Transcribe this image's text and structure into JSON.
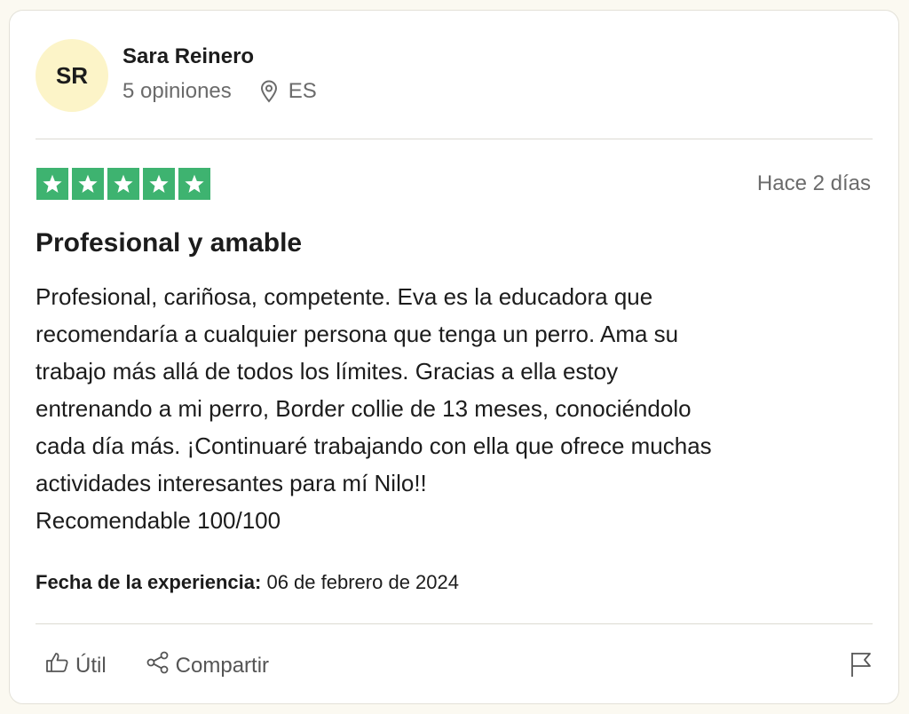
{
  "reviewer": {
    "initials": "SR",
    "name": "Sara Reinero",
    "review_count": "5 opiniones",
    "country": "ES"
  },
  "review": {
    "rating": 5,
    "rating_max": 5,
    "star_color": "#3eb370",
    "date_ago": "Hace 2 días",
    "title": "Profesional y amable",
    "body": "Profesional, cariñosa, competente. Eva es la educadora que\nrecomendaría a cualquier persona que tenga un perro. Ama su\ntrabajo más allá de todos los límites. Gracias a ella estoy\nentrenando a mi perro, Border collie de 13 meses, conociéndolo\ncada día más. ¡Continuaré trabajando con ella que ofrece muchas\nactividades interesantes para mí Nilo!!\nRecomendable 100/100",
    "experience_label": "Fecha de la experiencia:",
    "experience_date": "06 de febrero de 2024"
  },
  "actions": {
    "useful_label": "Útil",
    "share_label": "Compartir",
    "useful_icon": "thumbs-up-icon",
    "share_icon": "share-icon",
    "report_icon": "flag-icon"
  }
}
